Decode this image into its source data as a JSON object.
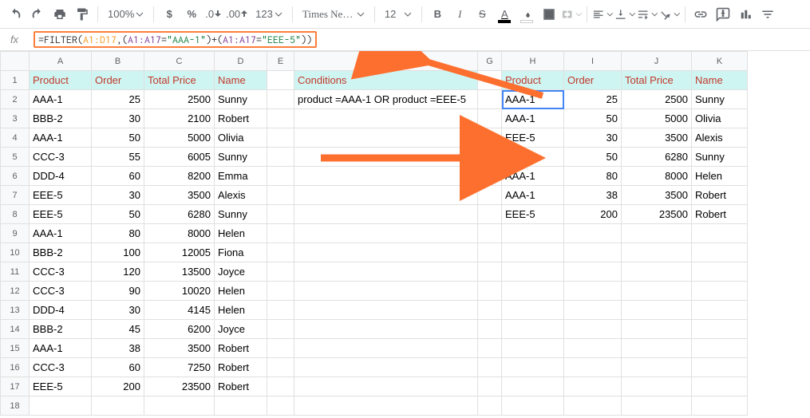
{
  "toolbar": {
    "zoom": "100%",
    "currency": "$",
    "percent": "%",
    "dec_dec": ".0",
    "dec_inc": ".00",
    "num_fmt": "123",
    "font": "Times Ne…",
    "size": "12",
    "bold": "B",
    "italic": "I",
    "strike": "S",
    "text_color": "A"
  },
  "formula": {
    "fx": "fx",
    "eq": "=",
    "fn": "FILTER",
    "open": "(",
    "ref1a": "A1:D17",
    "comma1": ",(",
    "ref2a": "A1:A17",
    "eq1": "=",
    "str1": "\"AAA-1\"",
    "close1": ")",
    "plus": "+",
    "open2": "(",
    "ref2b": "A1:A17",
    "eq2": "=",
    "str2": "\"EEE-5\"",
    "close2": "))"
  },
  "columns": [
    "A",
    "B",
    "C",
    "D",
    "E",
    "F",
    "G",
    "H",
    "I",
    "J",
    "K"
  ],
  "rows_count": 18,
  "left_headers": [
    "Product",
    "Order",
    "Total Price",
    "Name"
  ],
  "left_data": [
    [
      "AAA-1",
      "25",
      "2500",
      "Sunny"
    ],
    [
      "BBB-2",
      "30",
      "2100",
      "Robert"
    ],
    [
      "AAA-1",
      "50",
      "5000",
      "Olivia"
    ],
    [
      "CCC-3",
      "55",
      "6005",
      "Sunny"
    ],
    [
      "DDD-4",
      "60",
      "8200",
      "Emma"
    ],
    [
      "EEE-5",
      "30",
      "3500",
      "Alexis"
    ],
    [
      "EEE-5",
      "50",
      "6280",
      "Sunny"
    ],
    [
      "AAA-1",
      "80",
      "8000",
      "Helen"
    ],
    [
      "BBB-2",
      "100",
      "12005",
      "Fiona"
    ],
    [
      "CCC-3",
      "120",
      "13500",
      "Joyce"
    ],
    [
      "CCC-3",
      "90",
      "10020",
      "Helen"
    ],
    [
      "DDD-4",
      "30",
      "4145",
      "Helen"
    ],
    [
      "BBB-2",
      "45",
      "6200",
      "Joyce"
    ],
    [
      "AAA-1",
      "38",
      "3500",
      "Robert"
    ],
    [
      "CCC-3",
      "60",
      "7250",
      "Robert"
    ],
    [
      "EEE-5",
      "200",
      "23500",
      "Robert"
    ]
  ],
  "cond_header": "Conditions",
  "cond_value": "product =AAA-1 OR product =EEE-5",
  "right_headers": [
    "Product",
    "Order",
    "Total Price",
    "Name"
  ],
  "right_data": [
    [
      "AAA-1",
      "25",
      "2500",
      "Sunny"
    ],
    [
      "AAA-1",
      "50",
      "5000",
      "Olivia"
    ],
    [
      "EEE-5",
      "30",
      "3500",
      "Alexis"
    ],
    [
      "EEE-5",
      "50",
      "6280",
      "Sunny"
    ],
    [
      "AAA-1",
      "80",
      "8000",
      "Helen"
    ],
    [
      "AAA-1",
      "38",
      "3500",
      "Robert"
    ],
    [
      "EEE-5",
      "200",
      "23500",
      "Robert"
    ]
  ]
}
